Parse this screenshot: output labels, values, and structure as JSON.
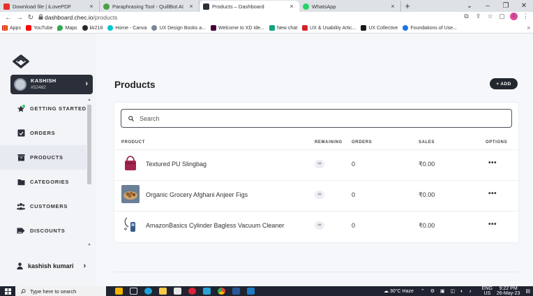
{
  "browser": {
    "tabs": [
      {
        "title": "Download file | iLovePDF",
        "favicon_color": "#e5322d",
        "active": false
      },
      {
        "title": "Paraphrasing Tool - QuillBot AI",
        "favicon_color": "#4ba046",
        "active": false
      },
      {
        "title": "Products – Dashboard",
        "favicon_color": "#2a2f3a",
        "active": true
      },
      {
        "title": "WhatsApp",
        "favicon_color": "#25d366",
        "active": false
      }
    ],
    "new_tab_label": "+",
    "close_label": "×",
    "window_controls": {
      "collapse": "⌄",
      "minimize": "–",
      "maximize": "❐",
      "close": "✕"
    },
    "url_host": "dashboard.chec.io",
    "url_path": "/products",
    "bookmarks": [
      {
        "label": "Apps",
        "color": "#d93025"
      },
      {
        "label": "YouTube",
        "color": "#ff0000"
      },
      {
        "label": "Maps",
        "color": "#34a853"
      },
      {
        "label": "kk218",
        "color": "#24292e"
      },
      {
        "label": "Home - Canva",
        "color": "#00c4cc"
      },
      {
        "label": "UX Design Books a...",
        "color": "#7b8794"
      },
      {
        "label": "Welcome to XD Ide...",
        "color": "#470137"
      },
      {
        "label": "New chat",
        "color": "#10a37f"
      },
      {
        "label": "UX & Usability Artic...",
        "color": "#d2232a"
      },
      {
        "label": "UX Collective",
        "color": "#1a1a1a"
      },
      {
        "label": "Foundations of Use...",
        "color": "#1a73e8"
      }
    ],
    "bookmarks_more": "»",
    "profile_initial": "k"
  },
  "sidebar": {
    "account_name": "KASHISH",
    "account_id": "#52482",
    "nav": [
      {
        "label": "GETTING STARTED",
        "icon": "star-icon",
        "active": false
      },
      {
        "label": "ORDERS",
        "icon": "orders-icon",
        "active": false
      },
      {
        "label": "PRODUCTS",
        "icon": "products-icon",
        "active": true
      },
      {
        "label": "CATEGORIES",
        "icon": "categories-icon",
        "active": false
      },
      {
        "label": "CUSTOMERS",
        "icon": "customers-icon",
        "active": false
      },
      {
        "label": "DISCOUNTS",
        "icon": "discounts-icon",
        "active": false
      }
    ],
    "user_name": "kashish kumari"
  },
  "main": {
    "title": "Products",
    "add_label": "+ ADD",
    "search_placeholder": "Search",
    "columns": {
      "product": "PRODUCT",
      "remaining": "REMAINING",
      "orders": "ORDERS",
      "sales": "SALES",
      "options": "OPTIONS"
    },
    "rows": [
      {
        "name": "Textured PU Slingbag",
        "remaining": "∞",
        "orders": "0",
        "sales": "₹0.00",
        "options": "•••"
      },
      {
        "name": "Organic Grocery Afghani Anjeer Figs",
        "remaining": "∞",
        "orders": "0",
        "sales": "₹0.00",
        "options": "•••"
      },
      {
        "name": "AmazonBasics Cylinder Bagless Vacuum Cleaner",
        "remaining": "∞",
        "orders": "0",
        "sales": "₹0.00",
        "options": "•••"
      }
    ]
  },
  "taskbar": {
    "search_placeholder": "Type here to search",
    "weather": "30°C Haze",
    "lang": "ENG",
    "region": "US",
    "time": "9:22 PM",
    "date": "26-May-23"
  },
  "colors": {
    "accent": "#22272f",
    "account_bg": "#2a2f3a",
    "getting_started_dot": "#2ecc71"
  }
}
